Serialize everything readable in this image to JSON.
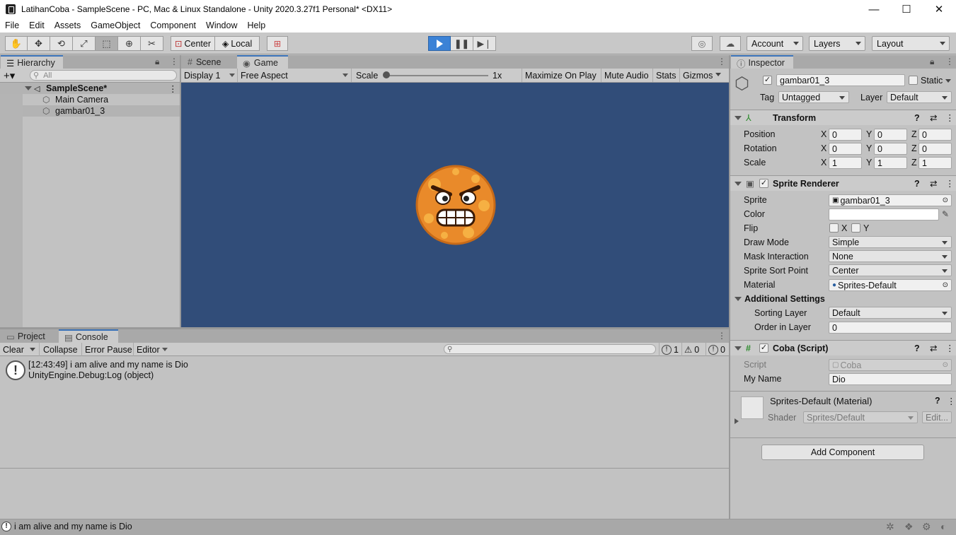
{
  "window": {
    "title": "LatihanCoba - SampleScene - PC, Mac & Linux Standalone - Unity 2020.3.27f1 Personal* <DX11>",
    "minimize": "—",
    "maximize": "☐",
    "close": "✕"
  },
  "menu": [
    "File",
    "Edit",
    "Assets",
    "GameObject",
    "Component",
    "Window",
    "Help"
  ],
  "toolbar": {
    "center": "Center",
    "local": "Local",
    "account": "Account",
    "layers": "Layers",
    "layout": "Layout",
    "colors": {
      "play_active": "#3b82d6"
    }
  },
  "hierarchy": {
    "tab": "Hierarchy",
    "search_placeholder": "All",
    "scene": "SampleScene*",
    "items": [
      "Main Camera",
      "gambar01_3"
    ]
  },
  "game_view": {
    "tabs": [
      "Scene",
      "Game"
    ],
    "display": "Display 1",
    "aspect": "Free Aspect",
    "scale_label": "Scale",
    "scale_value": "1x",
    "maximize_on_play": "Maximize On Play",
    "mute_audio": "Mute Audio",
    "stats": "Stats",
    "gizmos": "Gizmos",
    "background": "#314d79"
  },
  "console": {
    "tabs": [
      "Project",
      "Console"
    ],
    "clear": "Clear",
    "collapse": "Collapse",
    "error_pause": "Error Pause",
    "editor": "Editor",
    "counts": {
      "info": "1",
      "warn": "0",
      "error": "0"
    },
    "log": {
      "line1": "[12:43:49] i am alive and my name is Dio",
      "line2": "UnityEngine.Debug:Log (object)"
    }
  },
  "status_bar": {
    "message": "i am alive and my name is Dio"
  },
  "inspector": {
    "tab": "Inspector",
    "object_name": "gambar01_3",
    "static": "Static",
    "tag_label": "Tag",
    "tag": "Untagged",
    "layer_label": "Layer",
    "layer": "Default",
    "transform": {
      "title": "Transform",
      "rows": [
        {
          "label": "Position",
          "x": "0",
          "y": "0",
          "z": "0"
        },
        {
          "label": "Rotation",
          "x": "0",
          "y": "0",
          "z": "0"
        },
        {
          "label": "Scale",
          "x": "1",
          "y": "1",
          "z": "1"
        }
      ]
    },
    "sprite_renderer": {
      "title": "Sprite Renderer",
      "sprite_label": "Sprite",
      "sprite": "gambar01_3",
      "color_label": "Color",
      "flip_label": "Flip",
      "flip_x": "X",
      "flip_y": "Y",
      "draw_mode_label": "Draw Mode",
      "draw_mode": "Simple",
      "mask_label": "Mask Interaction",
      "mask": "None",
      "sort_point_label": "Sprite Sort Point",
      "sort_point": "Center",
      "material_label": "Material",
      "material": "Sprites-Default",
      "additional": "Additional Settings",
      "sorting_layer_label": "Sorting Layer",
      "sorting_layer": "Default",
      "order_label": "Order in Layer",
      "order": "0"
    },
    "script": {
      "title": "Coba (Script)",
      "script_label": "Script",
      "script": "Coba",
      "my_name_label": "My Name",
      "my_name": "Dio"
    },
    "material": {
      "title": "Sprites-Default (Material)",
      "shader_label": "Shader",
      "shader": "Sprites/Default",
      "edit": "Edit..."
    },
    "add_component": "Add Component"
  }
}
